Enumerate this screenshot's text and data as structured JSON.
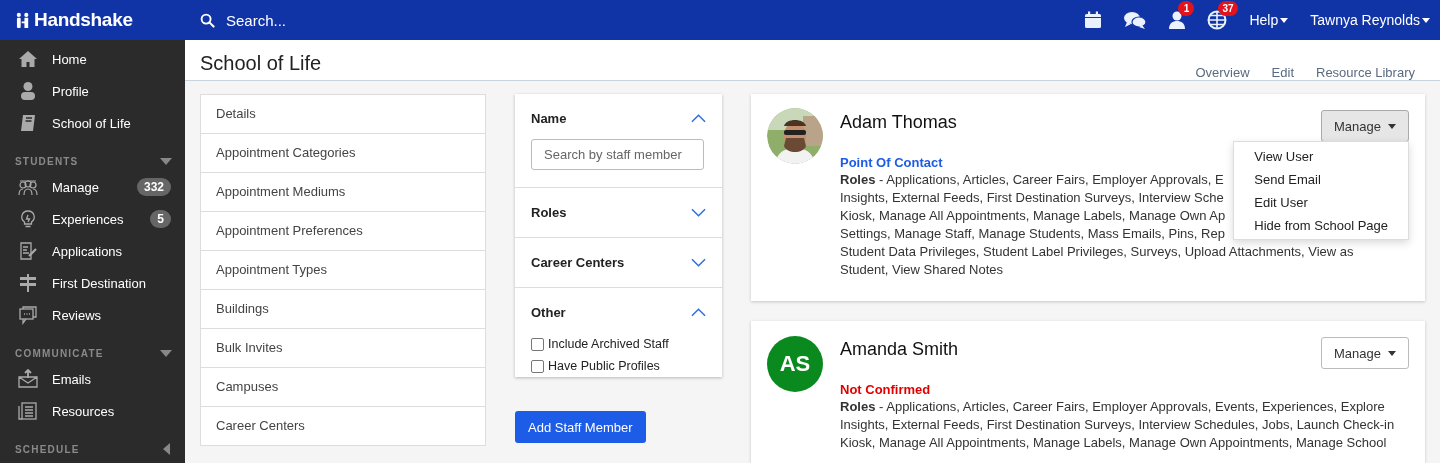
{
  "topbar": {
    "logo": "Handshake",
    "search": {
      "placeholder": "Search..."
    },
    "icons": [
      {
        "kind": "calendar"
      },
      {
        "kind": "chat"
      },
      {
        "kind": "person",
        "badge": "1"
      },
      {
        "kind": "globe",
        "badge": "37"
      }
    ],
    "help": "Help",
    "user": "Tawnya Reynolds"
  },
  "sidebar": {
    "items": [
      {
        "kind": "home",
        "label": "Home"
      },
      {
        "kind": "person",
        "label": "Profile"
      },
      {
        "kind": "book",
        "label": "School of Life"
      }
    ],
    "sections": [
      {
        "title": "STUDENTS",
        "expanded": true,
        "items": [
          {
            "kind": "group",
            "label": "Manage",
            "count": "332"
          },
          {
            "kind": "bulb",
            "label": "Experiences",
            "count": "5"
          },
          {
            "kind": "doc",
            "label": "Applications"
          },
          {
            "kind": "sign",
            "label": "First Destination"
          },
          {
            "kind": "review",
            "label": "Reviews"
          }
        ]
      },
      {
        "title": "COMMUNICATE",
        "expanded": true,
        "items": [
          {
            "kind": "mail",
            "label": "Emails"
          },
          {
            "kind": "news",
            "label": "Resources"
          }
        ]
      },
      {
        "title": "SCHEDULE",
        "expanded": false
      }
    ]
  },
  "page": {
    "title": "School of Life",
    "tabs": [
      "Overview",
      "Edit",
      "Resource Library"
    ]
  },
  "settings_list": [
    "Details",
    "Appointment Categories",
    "Appointment Mediums",
    "Appointment Preferences",
    "Appointment Types",
    "Buildings",
    "Bulk Invites",
    "Campuses",
    "Career Centers"
  ],
  "filters": {
    "sections": [
      {
        "title": "Name",
        "expanded": true,
        "kind": "search",
        "placeholder": "Search by staff member"
      },
      {
        "title": "Roles",
        "expanded": false
      },
      {
        "title": "Career Centers",
        "expanded": false
      },
      {
        "title": "Other",
        "expanded": true,
        "kind": "checks",
        "options": [
          {
            "label": "Include Archived Staff",
            "checked": false
          },
          {
            "label": "Have Public Profiles",
            "checked": false
          }
        ]
      }
    ],
    "button": "Add Staff Member"
  },
  "staff": [
    {
      "name": "Adam Thomas",
      "status": {
        "kind": "contact",
        "label": "Point Of Contact"
      },
      "roles_lines": [
        "**Roles** - Applications, Articles, Career Fairs, Employer Approvals, E",
        "Insights, External Feeds, First Destination Surveys, Interview Sche",
        "Kiosk, Manage All Appointments, Manage Labels, Manage Own Ap",
        "Settings, Manage Staff, Manage Students, Mass Emails, Pins, Rep",
        "Student Data Privileges, Student Label Privileges, Surveys, Upload Attachments, View as",
        "Student, View Shared Notes"
      ],
      "manage": {
        "label": "Manage",
        "expanded": true,
        "menu": [
          "View User",
          "Send Email",
          "Edit User",
          "Hide from School Page"
        ]
      }
    },
    {
      "name": "Amanda Smith",
      "avatar": {
        "kind": "initials",
        "text": "AS"
      },
      "status": {
        "kind": "unconfirmed",
        "label": "Not Confirmed"
      },
      "roles_lines": [
        "**Roles** - Applications, Articles, Career Fairs, Employer Approvals, Events, Experiences, Explore",
        "Insights, External Feeds, First Destination Surveys, Interview Schedules, Jobs, Launch Check-in",
        "Kiosk, Manage All Appointments, Manage Labels, Manage Own Appointments, Manage School"
      ],
      "manage": {
        "label": "Manage",
        "expanded": false
      }
    }
  ]
}
